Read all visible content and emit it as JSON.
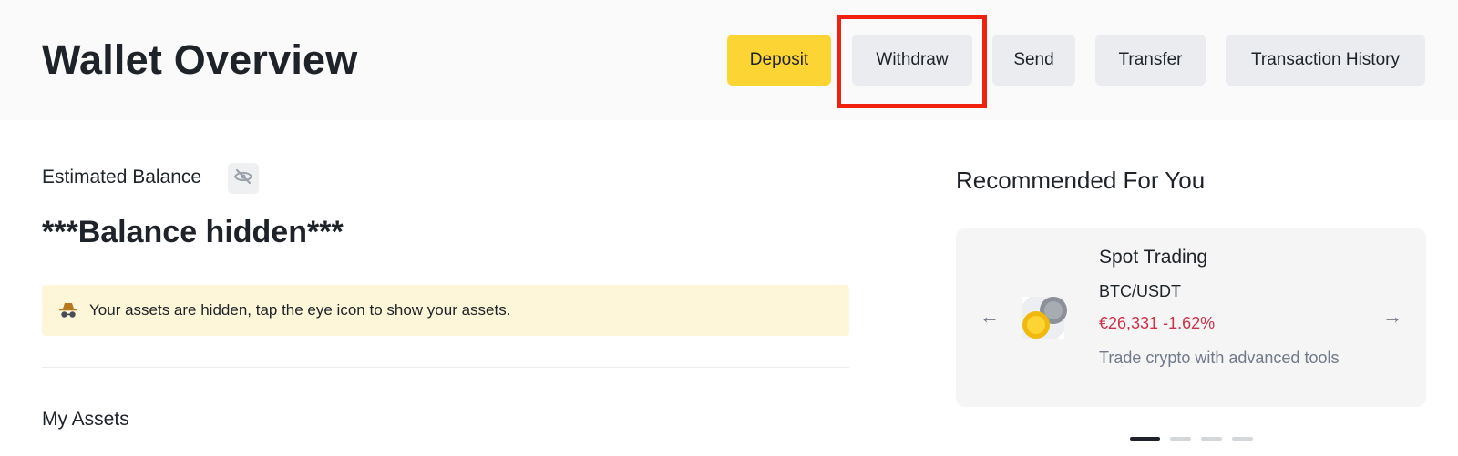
{
  "header": {
    "title": "Wallet Overview",
    "actions": {
      "deposit": "Deposit",
      "withdraw": "Withdraw",
      "send": "Send",
      "transfer": "Transfer",
      "history": "Transaction History"
    },
    "highlighted_action": "withdraw"
  },
  "balance": {
    "label": "Estimated Balance",
    "value": "***Balance hidden***",
    "toggle_icon": "eye-slash-icon"
  },
  "notice": {
    "icon": "incognito-icon",
    "text": "Your assets are hidden, tap the eye icon to show your assets."
  },
  "assets": {
    "title": "My Assets"
  },
  "recommended": {
    "title": "Recommended For You",
    "card": {
      "title": "Spot Trading",
      "pair": "BTC/USDT",
      "price": "€26,331 -1.62%",
      "description": "Trade crypto with advanced tools"
    },
    "carousel": {
      "count": 4,
      "active_index": 0
    }
  },
  "colors": {
    "accent": "#fcd535",
    "negative": "#cf304a",
    "highlight_border": "#f0220f",
    "notice_bg": "#fef6d8"
  }
}
